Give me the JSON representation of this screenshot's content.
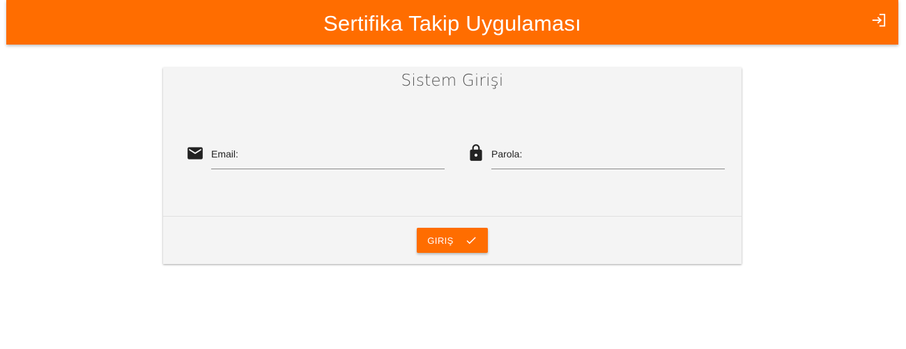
{
  "header": {
    "title": "Sertifika Takip Uygulaması",
    "login_icon": "login-icon"
  },
  "card": {
    "title": "Sistem Girişi",
    "email": {
      "label": "Email:",
      "icon": "mail-icon",
      "value": ""
    },
    "password": {
      "label": "Parola:",
      "icon": "lock-icon",
      "value": ""
    },
    "submit": {
      "label": "GIRIŞ",
      "icon": "check-icon"
    }
  },
  "colors": {
    "primary": "#ff6d00",
    "card_bg": "#f4f4f4"
  }
}
